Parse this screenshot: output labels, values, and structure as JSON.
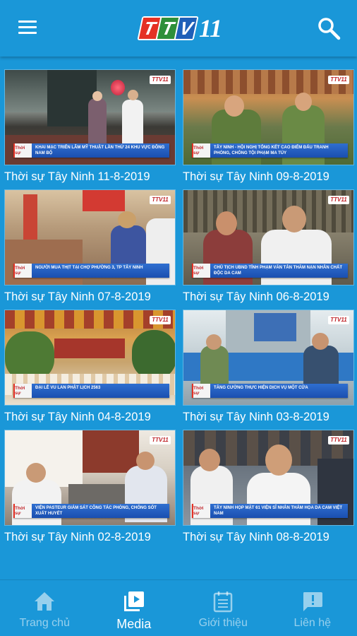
{
  "header": {
    "logo_letters": [
      "T",
      "T",
      "V"
    ],
    "logo_number": "11",
    "menu_icon": "hamburger-menu-icon",
    "search_icon": "search-icon"
  },
  "colors": {
    "primary": "#1a97d8",
    "logo_red": "#e53124",
    "logo_green": "#2e8f3a",
    "logo_blue": "#1e5fb8"
  },
  "videos": [
    {
      "title": "Thời sự Tây Ninh 11-8-2019",
      "tag": "Thời sự",
      "caption": "Khai mạc triển lãm mỹ thuật lần thứ 24 khu vực Đông Nam Bộ"
    },
    {
      "title": "Thời sự Tây Ninh 09-8-2019",
      "tag": "Thời sự",
      "caption": "Tây Ninh - Hội nghị tổng kết cao điểm đấu tranh phòng, chống tội phạm ma túy"
    },
    {
      "title": "Thời sự Tây Ninh 07-8-2019",
      "tag": "Thời sự",
      "caption": "Người mua thịt tại chợ Phường 3, TP Tây Ninh"
    },
    {
      "title": "Thời sự Tây Ninh 06-8-2019",
      "tag": "Thời sự",
      "caption": "Chủ tịch UBND tỉnh Phạm Văn Tân thăm nạn nhân chất độc da cam"
    },
    {
      "title": "Thời sự Tây Ninh 04-8-2019",
      "tag": "Thời sự",
      "caption": "Đại lễ Vu Lan Phật lịch 2563"
    },
    {
      "title": "Thời sự Tây Ninh 03-8-2019",
      "tag": "Thời sự",
      "caption": "Tăng cường thực hiện dịch vụ một cửa"
    },
    {
      "title": "Thời sự Tây Ninh 02-8-2019",
      "tag": "Thời sự",
      "caption": "Viện Pasteur giám sát công tác phòng, chống sốt xuất huyết"
    },
    {
      "title": "Thời sự Tây Ninh 08-8-2019",
      "tag": "Thời sự",
      "caption": "Tây Ninh họp mặt 61 viện sĩ nhân thảm họa da cam Việt Nam"
    }
  ],
  "nav": [
    {
      "label": "Trang chủ",
      "icon": "home-icon",
      "active": false
    },
    {
      "label": "Media",
      "icon": "video-library-icon",
      "active": true
    },
    {
      "label": "Giới thiệu",
      "icon": "calendar-icon",
      "active": false
    },
    {
      "label": "Liên hệ",
      "icon": "feedback-icon",
      "active": false
    }
  ]
}
